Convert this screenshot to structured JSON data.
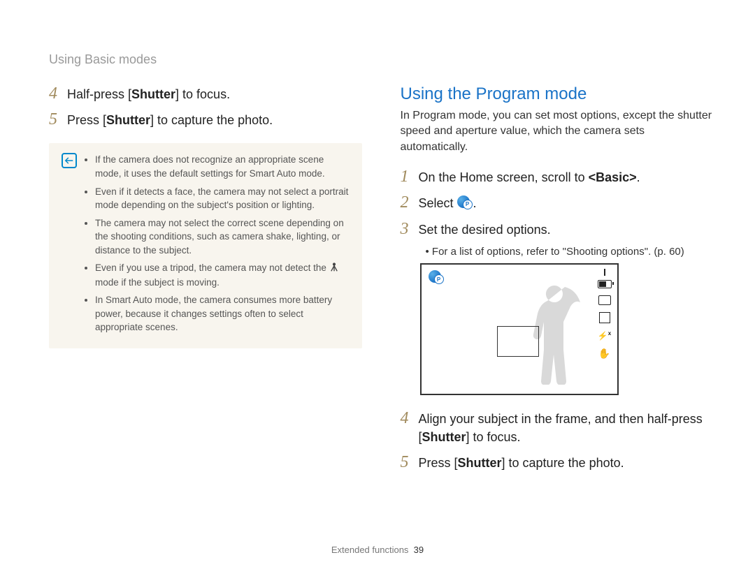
{
  "header": "Using Basic modes",
  "left": {
    "steps": [
      {
        "num": "4",
        "text_parts": [
          "Half-press [",
          "Shutter",
          "] to focus."
        ]
      },
      {
        "num": "5",
        "text_parts": [
          "Press [",
          "Shutter",
          "] to capture the photo."
        ]
      }
    ],
    "notes": [
      "If the camera does not recognize an appropriate scene mode, it uses the default settings for Smart Auto mode.",
      "Even if it detects a face, the camera may not select a portrait mode depending on the subject's position or lighting.",
      "The camera may not select the correct scene depending on the shooting conditions, such as camera shake, lighting, or distance to the subject.",
      "__TRIPOD__",
      "In Smart Auto mode, the camera consumes more battery power, because it changes settings often to select appropriate scenes."
    ],
    "tripod_note_pre": "Even if you use a tripod, the camera may not detect the ",
    "tripod_note_post": " mode if the subject is moving."
  },
  "right": {
    "heading": "Using the Program mode",
    "intro": "In Program mode, you can set most options, except the shutter speed and aperture value, which the camera sets automatically.",
    "steps": [
      {
        "num": "1",
        "text_parts": [
          "On the Home screen, scroll to ",
          "<Basic>",
          "."
        ]
      },
      {
        "num": "2",
        "text_parts": [
          "Select "
        ],
        "icon_after": true
      },
      {
        "num": "3",
        "text_parts": [
          "Set the desired options."
        ],
        "sub": "For a list of options, refer to \"Shooting options\". (p. 60)"
      },
      {
        "num": "4",
        "text_parts": [
          "Align your subject in the frame, and then half-press [",
          "Shutter",
          "] to focus."
        ]
      },
      {
        "num": "5",
        "text_parts": [
          "Press [",
          "Shutter",
          "] to capture the photo."
        ]
      }
    ]
  },
  "footer": {
    "section": "Extended functions",
    "page": "39"
  }
}
